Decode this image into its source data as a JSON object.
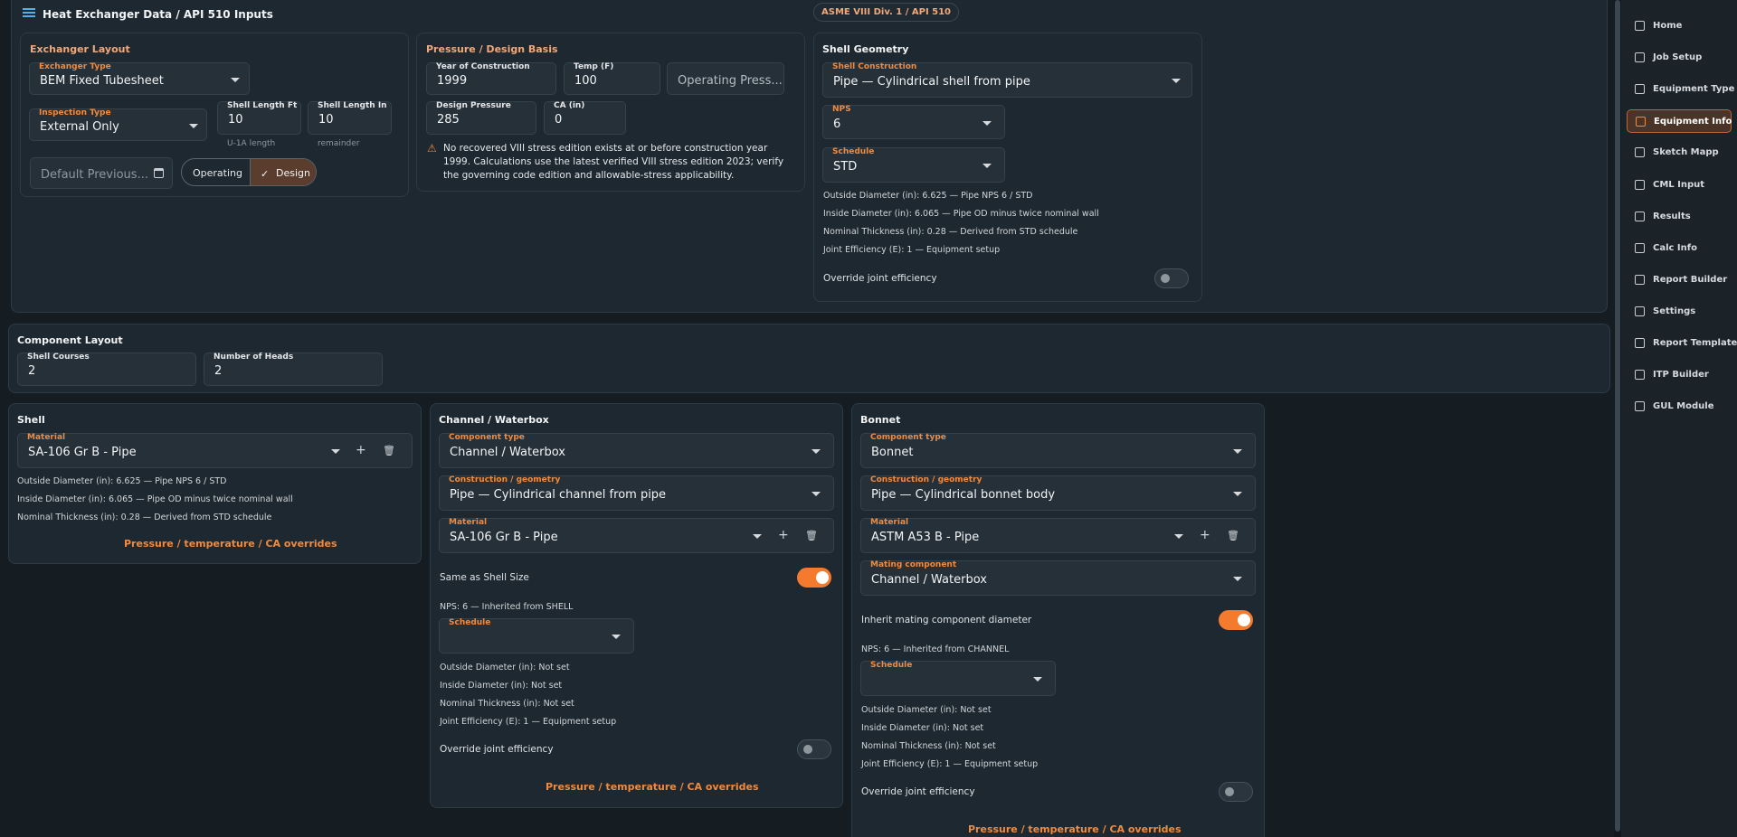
{
  "header": {
    "title": "Heat Exchanger Data / API 510 Inputs",
    "badge": "ASME VIII Div. 1 / API 510"
  },
  "exchanger_layout": {
    "title": "Exchanger Layout",
    "exchanger_type": {
      "label": "Exchanger Type",
      "value": "BEM Fixed Tubesheet"
    },
    "inspection_type": {
      "label": "Inspection Type",
      "value": "External Only"
    },
    "shell_length_ft": {
      "label": "Shell Length Ft",
      "value": "10",
      "hint": "U-1A length"
    },
    "shell_length_in": {
      "label": "Shell Length In",
      "value": "10",
      "hint": "remainder"
    },
    "default_previous": {
      "placeholder": "Default Previous..."
    },
    "mode_operating": "Operating",
    "mode_design": "Design"
  },
  "pressure_design": {
    "title": "Pressure / Design Basis",
    "year": {
      "label": "Year of Construction",
      "value": "1999"
    },
    "temp": {
      "label": "Temp (F)",
      "value": "100"
    },
    "operating_pressure": {
      "placeholder": "Operating Press..."
    },
    "design_pressure": {
      "label": "Design Pressure",
      "value": "285"
    },
    "ca": {
      "label": "CA (in)",
      "value": "0"
    },
    "warning": "No recovered VIII stress edition exists at or before construction year 1999. Calculations use the latest verified VIII stress edition 2023; verify the governing code edition and allowable-stress applicability."
  },
  "shell_geometry": {
    "title": "Shell Geometry",
    "construction": {
      "label": "Shell Construction",
      "value": "Pipe — Cylindrical shell from pipe"
    },
    "nps": {
      "label": "NPS",
      "value": "6"
    },
    "schedule": {
      "label": "Schedule",
      "value": "STD"
    },
    "info": [
      "Outside Diameter (in): 6.625 — Pipe NPS 6 / STD",
      "Inside Diameter (in): 6.065 — Pipe OD minus twice nominal wall",
      "Nominal Thickness (in): 0.28 — Derived from STD schedule",
      "Joint Efficiency (E): 1 — Equipment setup"
    ],
    "override_label": "Override joint efficiency"
  },
  "component_layout": {
    "title": "Component Layout",
    "shell_courses": {
      "label": "Shell Courses",
      "value": "2"
    },
    "number_of_heads": {
      "label": "Number of Heads",
      "value": "2"
    }
  },
  "shell": {
    "title": "Shell",
    "material": {
      "label": "Material",
      "value": "SA-106 Gr B - Pipe"
    },
    "info": [
      "Outside Diameter (in): 6.625 — Pipe NPS 6 / STD",
      "Inside Diameter (in): 6.065 — Pipe OD minus twice nominal wall",
      "Nominal Thickness (in): 0.28 — Derived from STD schedule"
    ],
    "overrides_link": "Pressure / temperature / CA overrides"
  },
  "channel": {
    "title": "Channel / Waterbox",
    "component_type": {
      "label": "Component type",
      "value": "Channel / Waterbox"
    },
    "construction": {
      "label": "Construction / geometry",
      "value": "Pipe — Cylindrical channel from pipe"
    },
    "material": {
      "label": "Material",
      "value": "SA-106 Gr B - Pipe"
    },
    "same_as_shell_label": "Same as Shell Size",
    "nps_info": "NPS: 6 — Inherited from SHELL",
    "schedule": {
      "label": "Schedule",
      "value": ""
    },
    "info": [
      "Outside Diameter (in): Not set",
      "Inside Diameter (in): Not set",
      "Nominal Thickness (in): Not set",
      "Joint Efficiency (E): 1 — Equipment setup"
    ],
    "override_label": "Override joint efficiency",
    "overrides_link": "Pressure / temperature / CA overrides"
  },
  "bonnet": {
    "title": "Bonnet",
    "component_type": {
      "label": "Component type",
      "value": "Bonnet"
    },
    "construction": {
      "label": "Construction / geometry",
      "value": "Pipe — Cylindrical bonnet body"
    },
    "material": {
      "label": "Material",
      "value": "ASTM A53 B - Pipe"
    },
    "mating": {
      "label": "Mating component",
      "value": "Channel / Waterbox"
    },
    "inherit_label": "Inherit mating component diameter",
    "nps_info": "NPS: 6 — Inherited from CHANNEL",
    "schedule": {
      "label": "Schedule",
      "value": ""
    },
    "info": [
      "Outside Diameter (in): Not set",
      "Inside Diameter (in): Not set",
      "Nominal Thickness (in): Not set",
      "Joint Efficiency (E): 1 — Equipment setup"
    ],
    "override_label": "Override joint efficiency",
    "overrides_link": "Pressure / temperature / CA overrides"
  },
  "sidebar": {
    "items": [
      {
        "label": "Home"
      },
      {
        "label": "Job Setup"
      },
      {
        "label": "Equipment Type"
      },
      {
        "label": "Equipment Info"
      },
      {
        "label": "Sketch Mapp"
      },
      {
        "label": "CML Input"
      },
      {
        "label": "Results"
      },
      {
        "label": "Calc Info"
      },
      {
        "label": "Report Builder"
      },
      {
        "label": "Settings"
      },
      {
        "label": "Report Template"
      },
      {
        "label": "ITP Builder"
      },
      {
        "label": "GUL Module"
      }
    ],
    "active_index": 3
  },
  "colors": {
    "accent": "#f47a2e",
    "background": "#151c22",
    "card": "#1d2830"
  }
}
